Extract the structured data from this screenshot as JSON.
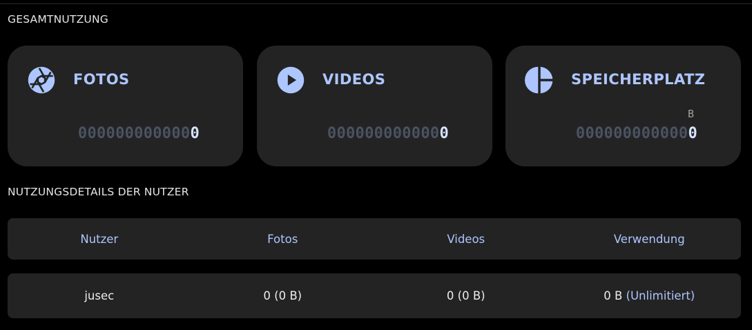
{
  "total_usage": {
    "section_title": "GESAMTNUTZUNG",
    "cards": [
      {
        "icon": "camera-aperture-icon",
        "title": "FOTOS",
        "unit": "",
        "value_padding": "000000000000",
        "value": "0"
      },
      {
        "icon": "play-circle-icon",
        "title": "VIDEOS",
        "unit": "",
        "value_padding": "000000000000",
        "value": "0"
      },
      {
        "icon": "pie-chart-icon",
        "title": "SPEICHERPLATZ",
        "unit": "B",
        "value_padding": "000000000000",
        "value": "0"
      }
    ]
  },
  "user_details": {
    "section_title": "NUTZUNGSDETAILS DER NUTZER",
    "columns": [
      "Nutzer",
      "Fotos",
      "Videos",
      "Verwendung"
    ],
    "rows": [
      {
        "user": "jusec",
        "photos": "0 (0 B)",
        "videos": "0 (0 B)",
        "usage": "0 B",
        "quota": "(Unlimitiert)"
      }
    ]
  },
  "colors": {
    "background": "#000000",
    "card": "#232323",
    "accent": "#adc6ff",
    "padding_digits": "#4b5362",
    "value_digit": "#d6e4ff"
  }
}
